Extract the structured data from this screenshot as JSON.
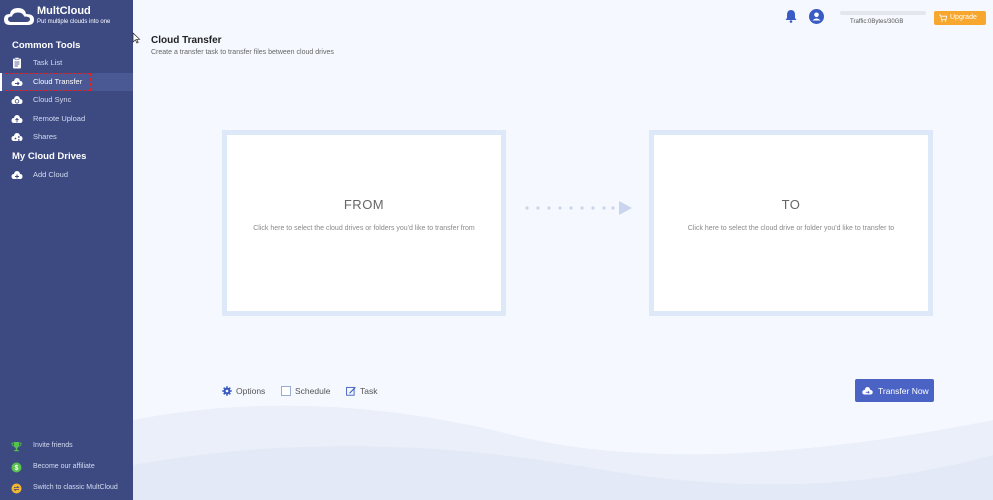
{
  "app": {
    "name": "MultCloud",
    "tagline": "Put multiple clouds into one"
  },
  "sidebar": {
    "section_common": "Common Tools",
    "section_drives": "My Cloud Drives",
    "items": [
      {
        "label": "Task List",
        "icon": "clipboard-icon"
      },
      {
        "label": "Cloud Transfer",
        "icon": "cloud-transfer-icon",
        "active": true
      },
      {
        "label": "Cloud Sync",
        "icon": "cloud-sync-icon"
      },
      {
        "label": "Remote Upload",
        "icon": "cloud-upload-icon"
      },
      {
        "label": "Shares",
        "icon": "cloud-share-icon"
      }
    ],
    "add_cloud": "Add Cloud",
    "bottom": [
      {
        "label": "Invite friends",
        "icon": "trophy-icon"
      },
      {
        "label": "Become our affiliate",
        "icon": "dollar-icon"
      },
      {
        "label": "Switch to classic MultCloud",
        "icon": "switch-icon"
      }
    ]
  },
  "header": {
    "traffic": "Traffic:0Bytes/30GB",
    "traffic_used_fraction": 0,
    "upgrade_label": "Upgrade"
  },
  "page": {
    "title": "Cloud Transfer",
    "subtitle": "Create a transfer task to transfer files between cloud drives"
  },
  "from_panel": {
    "heading": "FROM",
    "description": "Click here to select the cloud drives or folders you'd like to transfer from"
  },
  "to_panel": {
    "heading": "TO",
    "description": "Click here to select the cloud drive or folder you'd like to transfer to"
  },
  "options": {
    "options_label": "Options",
    "schedule_label": "Schedule",
    "task_label": "Task"
  },
  "transfer_button": "Transfer Now",
  "colors": {
    "sidebar": "#3d4a82",
    "primary": "#4a63c4",
    "upgrade": "#f7a72e",
    "highlight": "#e02020"
  }
}
